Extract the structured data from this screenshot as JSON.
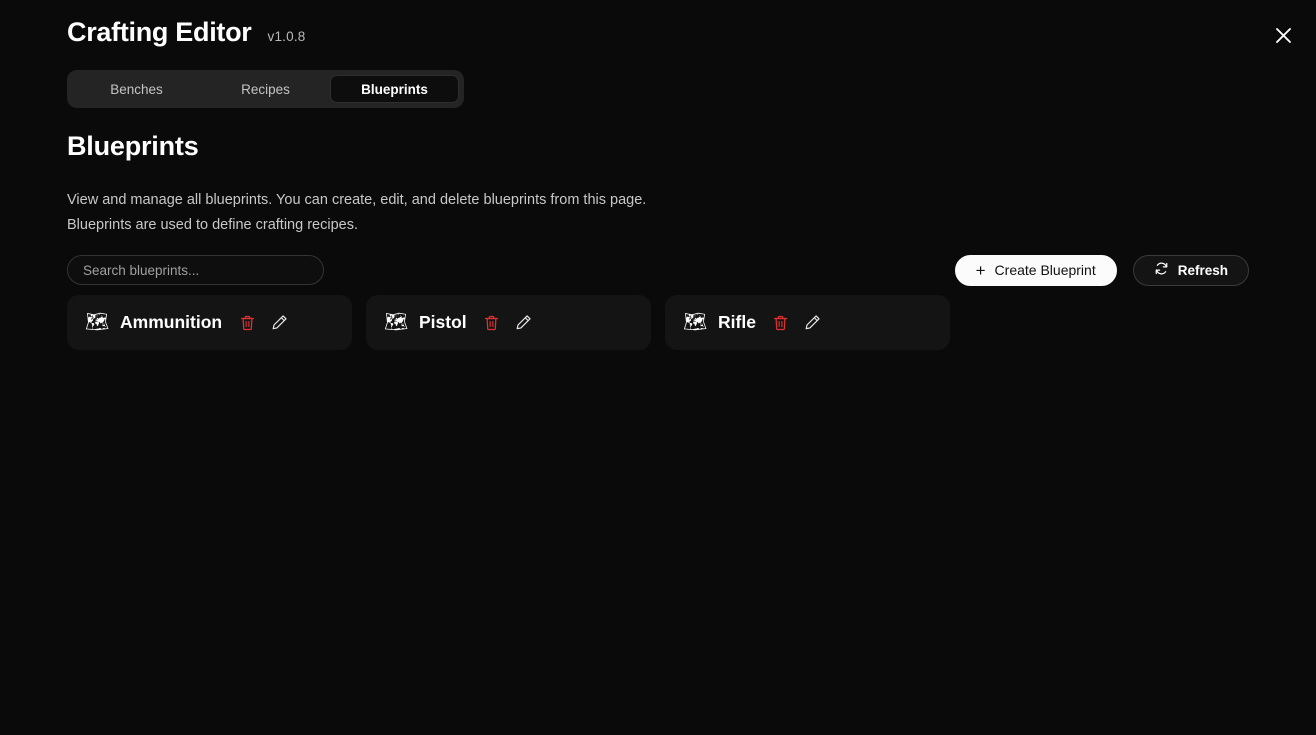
{
  "window": {
    "title": "Crafting Editor",
    "version": "v1.0.8",
    "close_icon": "close-x-icon"
  },
  "tabs": [
    {
      "label": "Benches",
      "active": false
    },
    {
      "label": "Recipes",
      "active": false
    },
    {
      "label": "Blueprints",
      "active": true
    }
  ],
  "page": {
    "heading": "Blueprints",
    "description_line1": "View and manage all blueprints. You can create, edit, and delete blueprints from this page.",
    "description_line2": "Blueprints are used to define crafting recipes."
  },
  "toolbar": {
    "search_placeholder": "Search blueprints...",
    "search_value": "",
    "create_label": "Create Blueprint",
    "create_icon": "plus-icon",
    "refresh_label": "Refresh",
    "refresh_icon": "refresh-icon"
  },
  "blueprints": [
    {
      "name": "Ammunition",
      "icon": "🗺",
      "delete_icon": "trash-icon",
      "edit_icon": "pencil-icon"
    },
    {
      "name": "Pistol",
      "icon": "🗺",
      "delete_icon": "trash-icon",
      "edit_icon": "pencil-icon"
    },
    {
      "name": "Rifle",
      "icon": "🗺",
      "delete_icon": "trash-icon",
      "edit_icon": "pencil-icon"
    }
  ],
  "colors": {
    "background": "#0a0a0a",
    "card": "#141414",
    "tabbar": "#242424",
    "tab_active": "#0d0d0d",
    "accent_primary": "#fbfbfb",
    "danger": "#e03131",
    "icon_blue": "#7cc0ee"
  }
}
